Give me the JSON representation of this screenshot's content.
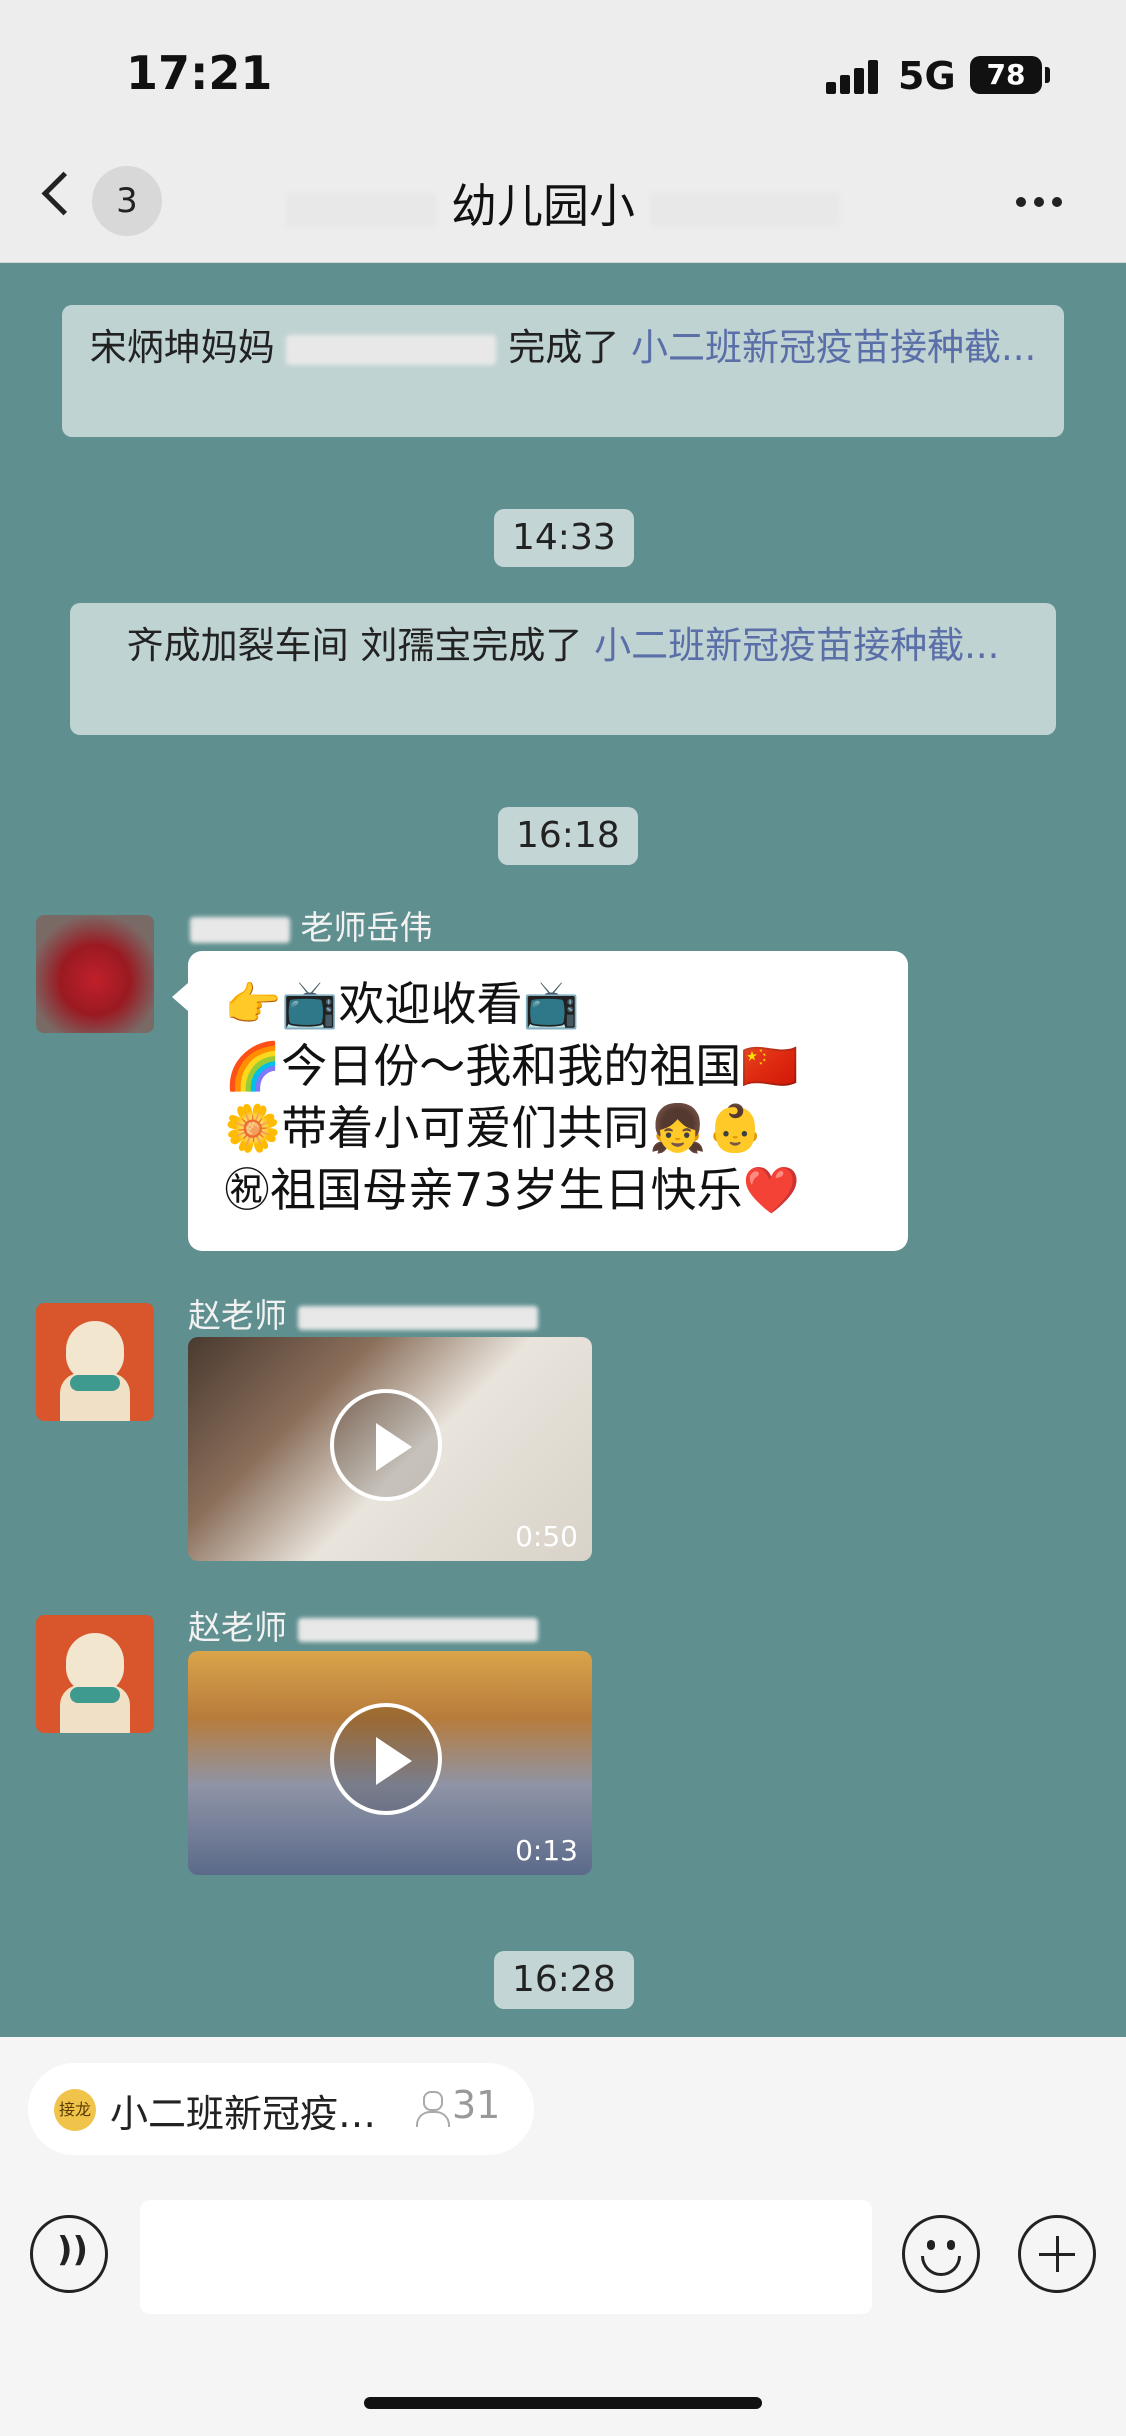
{
  "status_bar": {
    "time": "17:21",
    "network": "5G",
    "battery": "78"
  },
  "nav": {
    "unread_count": "3",
    "title": "幼儿园小"
  },
  "chat": {
    "system_messages": [
      {
        "text": "宋炳坤妈妈",
        "middle": "完成了 ",
        "link": "小二班新冠疫苗接种截..."
      },
      {
        "text": "齐成加裂车间 刘孺宝完成了 ",
        "link": "小二班新冠疫苗接种截..."
      }
    ],
    "timestamps": [
      "14:33",
      "16:18",
      "16:28"
    ],
    "messages": [
      {
        "sender": "老师岳伟",
        "lines": [
          "👉📺欢迎收看📺",
          "🌈今日份～我和我的祖国🇨🇳",
          "🌼带着小可爱们共同👧👶",
          "㊗祖国母亲73岁生日快乐❤️"
        ]
      },
      {
        "sender": "赵老师",
        "video_duration": "0:50"
      },
      {
        "sender": "赵老师",
        "video_duration": "0:13"
      }
    ]
  },
  "bottom_bar": {
    "solitaire_icon": "接龙",
    "solitaire_title": "小二班新冠疫…",
    "solitaire_count": "31",
    "input_placeholder": ""
  }
}
